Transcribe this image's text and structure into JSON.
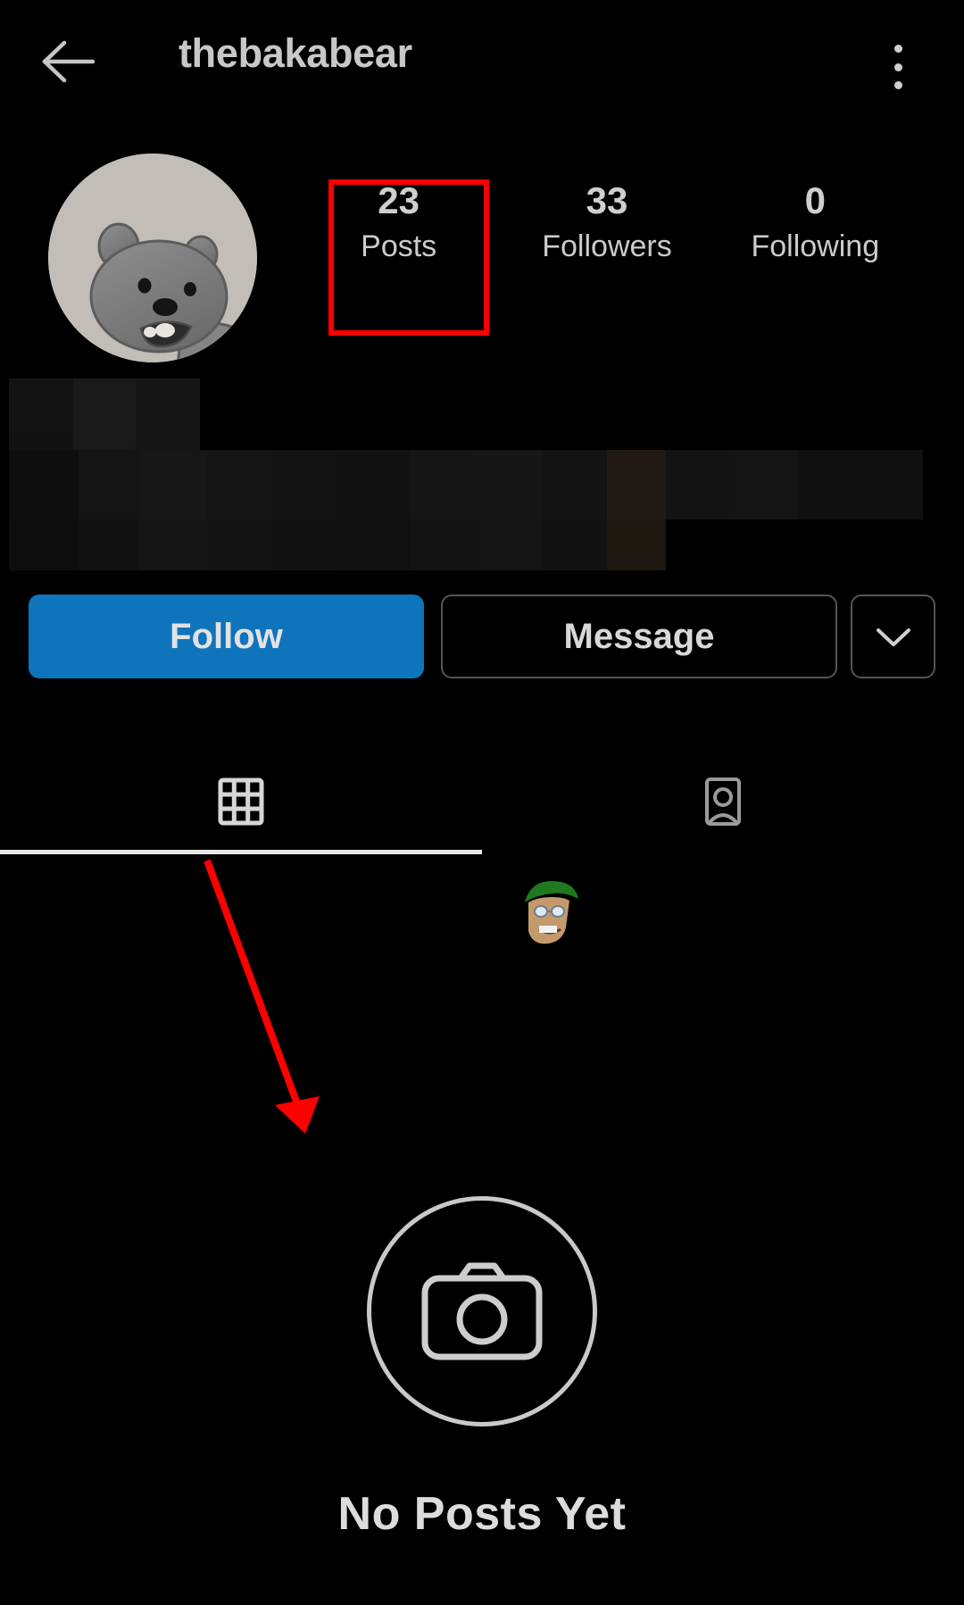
{
  "app": "instagram-profile",
  "theme": {
    "background": "#000000",
    "text_primary": "#cfcfcf",
    "accent_blue": "#0e74bc",
    "annotation_red": "#ff0000"
  },
  "header": {
    "back_icon": "arrow-left-icon",
    "title": "thebakabear",
    "overflow_icon": "more-vertical-icon"
  },
  "profile": {
    "avatar_icon": "bear-avatar",
    "bio_redacted": true,
    "stats": [
      {
        "value": "23",
        "label": "Posts",
        "highlighted": true
      },
      {
        "value": "33",
        "label": "Followers",
        "highlighted": false
      },
      {
        "value": "0",
        "label": "Following",
        "highlighted": false
      }
    ]
  },
  "actions": {
    "follow_label": "Follow",
    "message_label": "Message",
    "more_icon": "chevron-down-icon"
  },
  "tabs": [
    {
      "icon": "grid-icon",
      "name": "posts-grid",
      "selected": true
    },
    {
      "icon": "tagged-person-icon",
      "name": "tagged",
      "selected": false
    }
  ],
  "empty_state": {
    "icon": "camera-icon",
    "title": "No Posts Yet"
  },
  "annotations": {
    "highlight_box_target": "Posts",
    "arrow_icon": "annotation-arrow-icon"
  }
}
